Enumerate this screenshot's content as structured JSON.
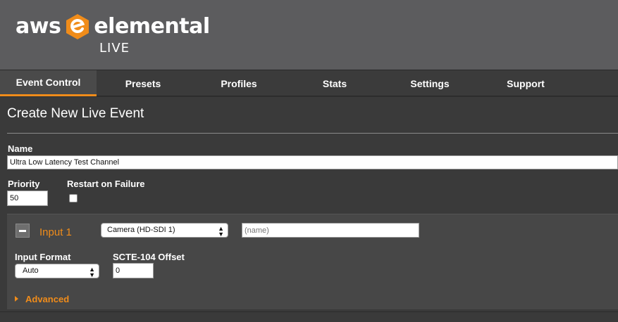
{
  "brand": {
    "name_left": "aws",
    "name_right": "elemental",
    "product": "LIVE",
    "accent": "#f08c1a"
  },
  "nav": {
    "tabs": [
      {
        "label": "Event Control",
        "active": true
      },
      {
        "label": "Presets"
      },
      {
        "label": "Profiles"
      },
      {
        "label": "Stats"
      },
      {
        "label": "Settings"
      },
      {
        "label": "Support"
      }
    ]
  },
  "page": {
    "title": "Create New Live Event"
  },
  "form": {
    "name_label": "Name",
    "name_value": "Ultra Low Latency Test Channel",
    "priority_label": "Priority",
    "priority_value": "50",
    "restart_label": "Restart on Failure",
    "restart_checked": false
  },
  "input1": {
    "title": "Input 1",
    "source_selected": "Camera (HD-SDI 1)",
    "name_placeholder": "(name)",
    "format_label": "Input Format",
    "format_selected": "Auto",
    "scte_label": "SCTE-104 Offset",
    "scte_value": "0",
    "advanced_label": "Advanced"
  },
  "icons": {
    "collapse": "minus-icon",
    "select_arrows": "updown-arrows-icon",
    "expand": "triangle-right-icon"
  }
}
